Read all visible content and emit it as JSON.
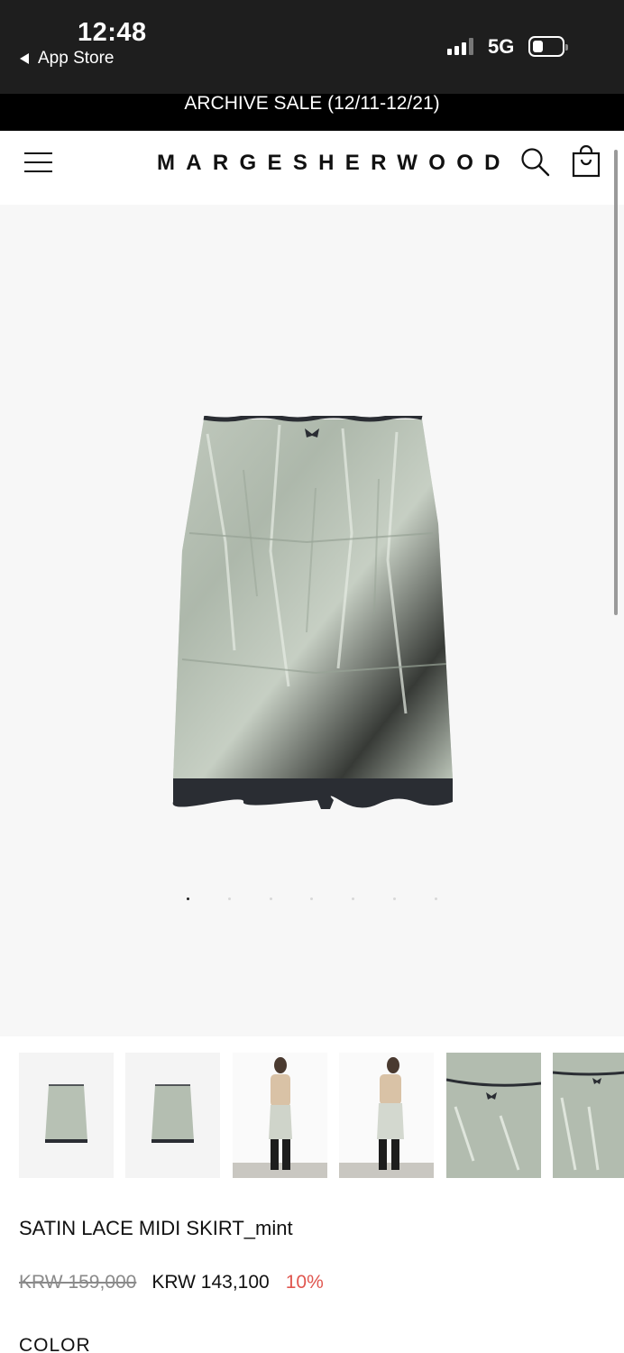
{
  "status_bar": {
    "time": "12:48",
    "back_label": "App Store",
    "network": "5G",
    "signal_icon": "cellular-signal-icon",
    "battery_icon": "battery-icon"
  },
  "promo": {
    "text": "ARCHIVE SALE (12/11-12/21)"
  },
  "header": {
    "logo": "MARGESHERWOOD",
    "menu_icon": "hamburger-menu-icon",
    "search_icon": "search-icon",
    "cart_icon": "shopping-bag-icon"
  },
  "gallery": {
    "image_count": 7,
    "active_index": 0,
    "thumbnail_count": 6
  },
  "product": {
    "title": "SATIN LACE MIDI SKIRT_mint",
    "original_price": "KRW 159,000",
    "sale_price": "KRW 143,100",
    "discount": "10%",
    "color_label": "COLOR"
  },
  "colors": {
    "status_bar_bg": "#1e1e1e",
    "promo_bg": "#000000",
    "hero_bg": "#f7f7f7",
    "discount": "#e0564f",
    "skirt_mint": "#b9c3b6",
    "lace": "#2a2d33"
  }
}
